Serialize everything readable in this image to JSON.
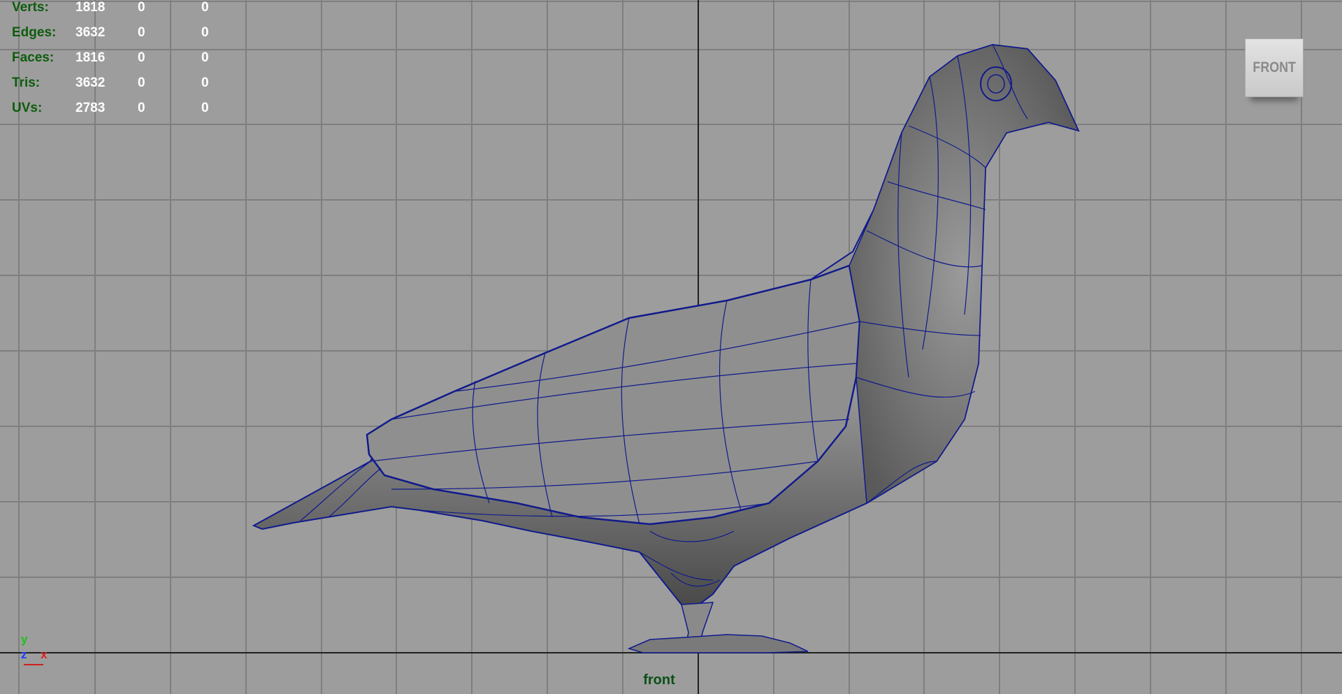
{
  "viewport": {
    "camera_label": "front",
    "view_cube_label": "FRONT"
  },
  "hud": {
    "rows": [
      {
        "label": "Verts:",
        "v1": "1818",
        "v2": "0",
        "v3": "0"
      },
      {
        "label": "Edges:",
        "v1": "3632",
        "v2": "0",
        "v3": "0"
      },
      {
        "label": "Faces:",
        "v1": "1816",
        "v2": "0",
        "v3": "0"
      },
      {
        "label": "Tris:",
        "v1": "3632",
        "v2": "0",
        "v3": "0"
      },
      {
        "label": "UVs:",
        "v1": "2783",
        "v2": "0",
        "v3": "0"
      }
    ]
  },
  "axis_indicator": {
    "y": "y",
    "z": "z",
    "x": "x"
  },
  "colors": {
    "background": "#9d9d9d",
    "grid": "#7e7e7e",
    "axis_line": "#202020",
    "wireframe": "#101a8c",
    "hud_label": "#0d5c0d",
    "hud_value": "#ffffff"
  },
  "icons": {
    "view_cube": "viewcube-icon",
    "axis": "axis-gizmo-icon"
  }
}
